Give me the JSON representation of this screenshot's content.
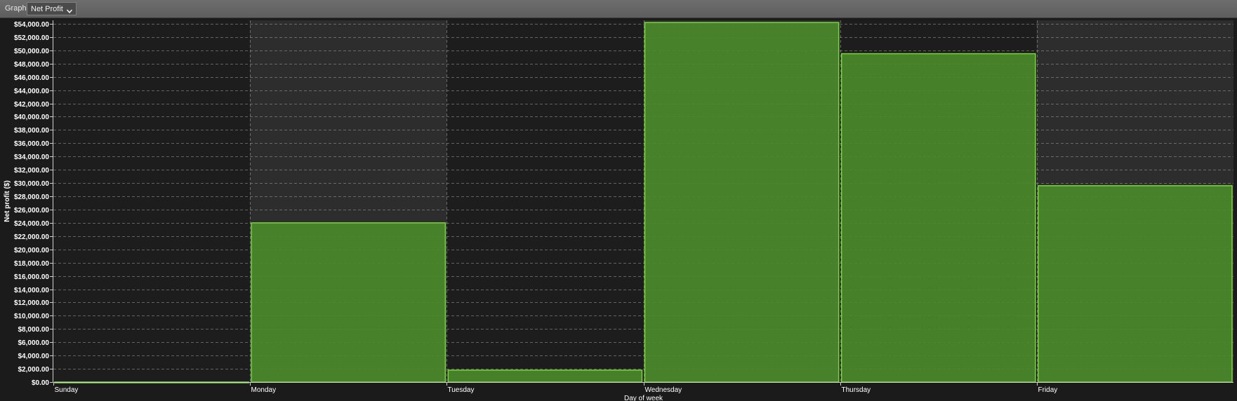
{
  "toolbar": {
    "label": "Graph",
    "graph_select": {
      "selected": "Net Profit",
      "icon": "chevron-down-icon"
    }
  },
  "colors": {
    "bar_fill": "#4a8a2a",
    "bar_edge": "#7bd43e",
    "band_dark": "#1d1d1d",
    "band_light": "#2d2d2d",
    "upper_light": "#353535",
    "grid": "#9a9a9a",
    "text": "#ffffff"
  },
  "chart_data": {
    "type": "bar",
    "categories": [
      "Sunday",
      "Monday",
      "Tuesday",
      "Wednesday",
      "Thursday",
      "Friday"
    ],
    "values": [
      0,
      24000,
      1800,
      54200,
      49500,
      29600
    ],
    "xlabel": "Day of week",
    "ylabel": "Net profit ($)",
    "ylim": [
      0,
      54000
    ],
    "ytick_step": 2000,
    "yticks": [
      "$0.00",
      "$2,000.00",
      "$4,000.00",
      "$6,000.00",
      "$8,000.00",
      "$10,000.00",
      "$12,000.00",
      "$14,000.00",
      "$16,000.00",
      "$18,000.00",
      "$20,000.00",
      "$22,000.00",
      "$24,000.00",
      "$26,000.00",
      "$28,000.00",
      "$30,000.00",
      "$32,000.00",
      "$34,000.00",
      "$36,000.00",
      "$38,000.00",
      "$40,000.00",
      "$42,000.00",
      "$44,000.00",
      "$46,000.00",
      "$48,000.00",
      "$50,000.00",
      "$52,000.00",
      "$54,000.00"
    ],
    "grid": true,
    "legend": "none"
  }
}
